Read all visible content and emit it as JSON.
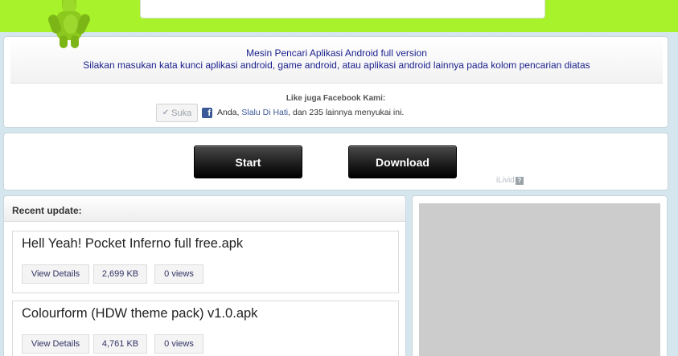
{
  "info": {
    "title": "Mesin Pencari Aplikasi Android full version",
    "subtitle": "Silakan masukan kata kunci aplikasi android, game android, atau aplikasi android lainnya pada kolom pencarian diatas",
    "facebook_title": "Like juga Facebook Kami:",
    "like_button": "Suka",
    "like_text_prefix": "Anda, ",
    "like_text_link": "Slalu Di Hati",
    "like_text_suffix": ", dan 235 lainnya menyukai ini."
  },
  "buttons": {
    "start": "Start",
    "download": "Download",
    "provider": "iLivid",
    "help": "?"
  },
  "recent": {
    "title": "Recent update:",
    "items": [
      {
        "title": "Hell Yeah! Pocket Inferno full free.apk",
        "details": "View Details",
        "size": "2,699 KB",
        "views": "0 views"
      },
      {
        "title": "Colourform (HDW theme pack) v1.0.apk",
        "details": "View Details",
        "size": "4,761 KB",
        "views": "0 views"
      }
    ]
  },
  "colors": {
    "topbar": "#a7f22a",
    "background": "#d6e6ee",
    "link": "#1a1f8c",
    "facebook": "#3b5998"
  }
}
